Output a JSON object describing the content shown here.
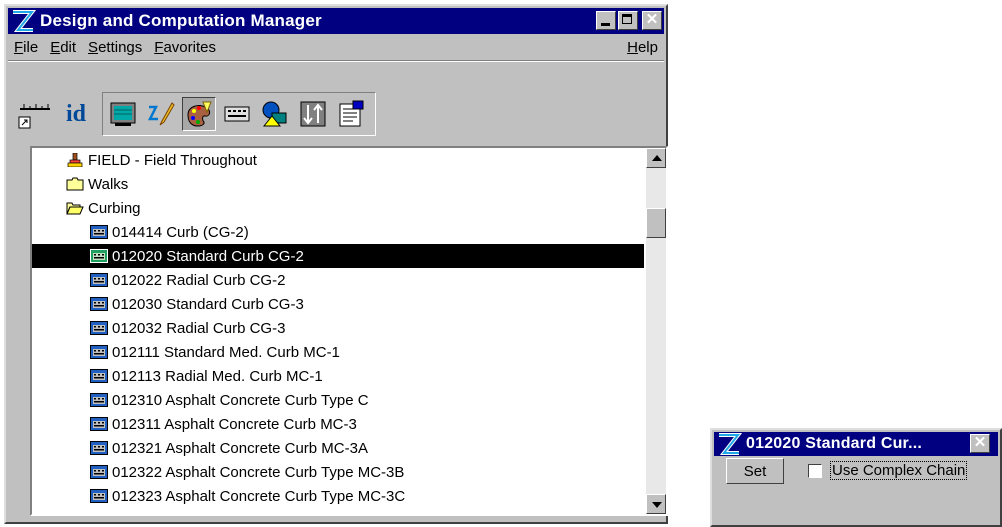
{
  "main_window": {
    "title": "Design and Computation Manager",
    "menu": [
      "File",
      "Edit",
      "Settings",
      "Favorites"
    ],
    "help": "Help",
    "toolbar": {
      "id_label": "id",
      "icons": [
        "ruler-icon",
        "id-icon",
        "dialog-icon",
        "draw-icon",
        "paint-palette-icon",
        "keypad-icon",
        "shapes-icon",
        "transfer-icon",
        "properties-icon"
      ],
      "pressed": "paint-palette-icon"
    },
    "tree": {
      "items": [
        {
          "label": "FIELD - Field Throughout",
          "icon": "paintbrush-icon",
          "indent": 0,
          "selected": false
        },
        {
          "label": "Walks",
          "icon": "folder-closed-icon",
          "indent": 0,
          "selected": false
        },
        {
          "label": "Curbing",
          "icon": "folder-open-icon",
          "indent": 0,
          "selected": false
        },
        {
          "label": "014414 Curb (CG-2)",
          "icon": "item-icon",
          "indent": 1,
          "selected": false
        },
        {
          "label": "012020 Standard Curb CG-2",
          "icon": "item-icon",
          "indent": 1,
          "selected": true
        },
        {
          "label": "012022 Radial Curb CG-2",
          "icon": "item-icon",
          "indent": 1,
          "selected": false
        },
        {
          "label": "012030 Standard Curb CG-3",
          "icon": "item-icon",
          "indent": 1,
          "selected": false
        },
        {
          "label": "012032 Radial Curb CG-3",
          "icon": "item-icon",
          "indent": 1,
          "selected": false
        },
        {
          "label": "012111 Standard Med. Curb MC-1",
          "icon": "item-icon",
          "indent": 1,
          "selected": false
        },
        {
          "label": "012113 Radial Med. Curb MC-1",
          "icon": "item-icon",
          "indent": 1,
          "selected": false
        },
        {
          "label": "012310 Asphalt Concrete Curb Type C",
          "icon": "item-icon",
          "indent": 1,
          "selected": false
        },
        {
          "label": "012311 Asphalt Concrete Curb MC-3",
          "icon": "item-icon",
          "indent": 1,
          "selected": false
        },
        {
          "label": "012321 Asphalt Concrete Curb MC-3A",
          "icon": "item-icon",
          "indent": 1,
          "selected": false
        },
        {
          "label": "012322 Asphalt Concrete Curb Type MC-3B",
          "icon": "item-icon",
          "indent": 1,
          "selected": false
        },
        {
          "label": "012323 Asphalt Concrete Curb Type MC-3C",
          "icon": "item-icon",
          "indent": 1,
          "selected": false
        }
      ]
    }
  },
  "dialog": {
    "title": "012020 Standard Cur...",
    "set_label": "Set",
    "checkbox_label": "Use Complex Chain",
    "checkbox_checked": false
  },
  "colors": {
    "titlebar": "#000080",
    "face": "#c0c0c0",
    "selection": "#000000"
  }
}
